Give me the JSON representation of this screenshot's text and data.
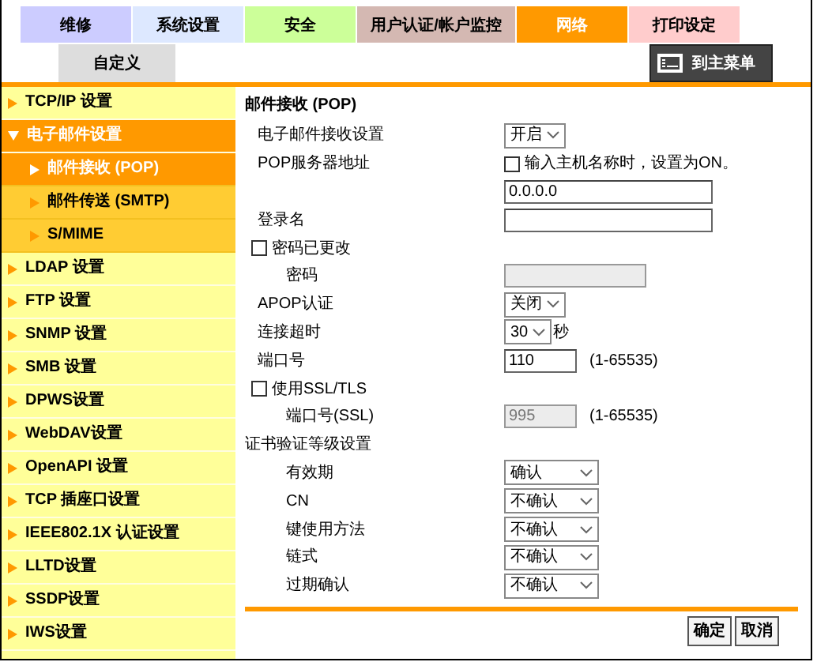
{
  "top_tabs": [
    {
      "label": "维修",
      "color": "#ccccff",
      "selected": false
    },
    {
      "label": "系统设置",
      "color": "#dde8ff",
      "selected": false
    },
    {
      "label": "安全",
      "color": "#ccff99",
      "selected": false
    },
    {
      "label": "用户认证/帐户监控",
      "color": "#d4b8b2",
      "selected": false
    },
    {
      "label": "网络",
      "color": "#ff9900",
      "selected": true
    },
    {
      "label": "打印设定",
      "color": "#ffcccc",
      "selected": false
    }
  ],
  "custom_tab": {
    "label": "自定义",
    "selected": false
  },
  "home_button": {
    "label": "到主菜单"
  },
  "sidebar": {
    "items": [
      {
        "label": "TCP/IP 设置",
        "selected": false
      },
      {
        "label": "电子邮件设置",
        "selected": true,
        "expanded": true,
        "children": [
          {
            "label": "邮件接收 (POP)",
            "selected": true
          },
          {
            "label": "邮件传送 (SMTP)",
            "selected": false
          },
          {
            "label": "S/MIME",
            "selected": false
          }
        ]
      },
      {
        "label": "LDAP 设置",
        "selected": false
      },
      {
        "label": "FTP 设置",
        "selected": false
      },
      {
        "label": "SNMP 设置",
        "selected": false
      },
      {
        "label": "SMB 设置",
        "selected": false
      },
      {
        "label": "DPWS设置",
        "selected": false
      },
      {
        "label": "WebDAV设置",
        "selected": false
      },
      {
        "label": "OpenAPI 设置",
        "selected": false
      },
      {
        "label": "TCP 插座口设置",
        "selected": false
      },
      {
        "label": "IEEE802.1X 认证设置",
        "selected": false
      },
      {
        "label": "LLTD设置",
        "selected": false
      },
      {
        "label": "SSDP设置",
        "selected": false
      },
      {
        "label": "IWS设置",
        "selected": false
      }
    ]
  },
  "form": {
    "title": "邮件接收 (POP)",
    "rows": [
      {
        "kind": "select",
        "label": "电子邮件接收设置",
        "value": "开启"
      },
      {
        "kind": "check-right",
        "label": "POP服务器地址",
        "check_label": "输入主机名称时，设置为ON。",
        "checked": false
      },
      {
        "kind": "input",
        "value": "0.0.0.0",
        "disabled": false
      },
      {
        "kind": "input",
        "label": "登录名",
        "disabled": false
      },
      {
        "kind": "checkbox",
        "label": "密码已更改",
        "checked": false,
        "children": [
          {
            "kind": "input",
            "label": "密码",
            "disabled": true
          }
        ]
      },
      {
        "kind": "select",
        "label": "APOP认证",
        "value": "关闭"
      },
      {
        "kind": "select",
        "label": "连接超时",
        "value": "30",
        "unit": "秒"
      },
      {
        "kind": "input",
        "label": "端口号",
        "value": "110",
        "range": "(1-65535)",
        "disabled": false
      },
      {
        "kind": "checkbox",
        "label": "使用SSL/TLS",
        "checked": false,
        "children": [
          {
            "kind": "input",
            "label": "端口号(SSL)",
            "value": "995",
            "range": "(1-65535)",
            "disabled": true
          }
        ]
      },
      {
        "kind": "heading",
        "label": "证书验证等级设置",
        "children": [
          {
            "kind": "select",
            "label": "有效期",
            "value": "确认"
          },
          {
            "kind": "select",
            "label": "CN",
            "value": "不确认"
          },
          {
            "kind": "select",
            "label": "键使用方法",
            "value": "不确认"
          },
          {
            "kind": "select",
            "label": "链式",
            "value": "不确认"
          },
          {
            "kind": "select",
            "label": "过期确认",
            "value": "不确认"
          }
        ]
      }
    ]
  },
  "buttons": [
    {
      "label": "确定"
    },
    {
      "label": "取消"
    }
  ]
}
